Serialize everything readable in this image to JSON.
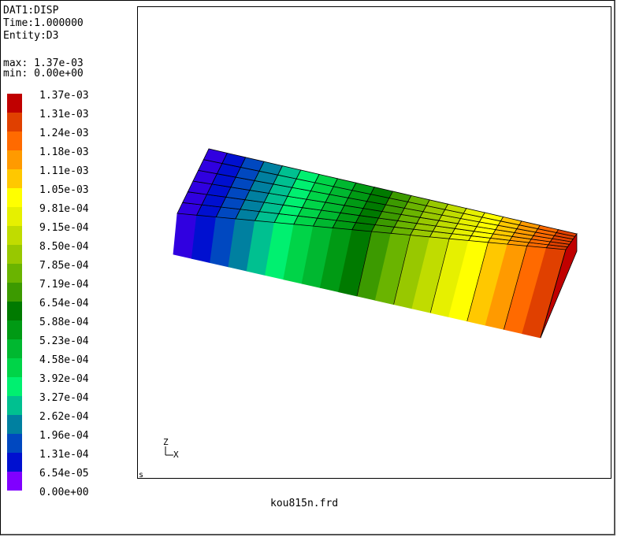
{
  "info": {
    "dataset": "DAT1:DISP",
    "time": "Time:1.000000",
    "entity": "Entity:D3"
  },
  "range": {
    "max": "max: 1.37e-03",
    "min": "min: 0.00e+00"
  },
  "legend": {
    "entries": [
      {
        "label": "1.37e-03",
        "color": "#c00000"
      },
      {
        "label": "1.31e-03",
        "color": "#e04000"
      },
      {
        "label": "1.24e-03",
        "color": "#ff6a00"
      },
      {
        "label": "1.18e-03",
        "color": "#ff9a00"
      },
      {
        "label": "1.11e-03",
        "color": "#ffc800"
      },
      {
        "label": "1.05e-03",
        "color": "#ffff00"
      },
      {
        "label": "9.81e-04",
        "color": "#e6f000"
      },
      {
        "label": "9.15e-04",
        "color": "#c0dc00"
      },
      {
        "label": "8.50e-04",
        "color": "#98c800"
      },
      {
        "label": "7.85e-04",
        "color": "#6ab400"
      },
      {
        "label": "7.19e-04",
        "color": "#3c9a00"
      },
      {
        "label": "6.54e-04",
        "color": "#007a00"
      },
      {
        "label": "5.88e-04",
        "color": "#009a14"
      },
      {
        "label": "5.23e-04",
        "color": "#00b830"
      },
      {
        "label": "4.58e-04",
        "color": "#00d448"
      },
      {
        "label": "3.92e-04",
        "color": "#00f070"
      },
      {
        "label": "3.27e-04",
        "color": "#00c090"
      },
      {
        "label": "2.62e-04",
        "color": "#0080a0"
      },
      {
        "label": "1.96e-04",
        "color": "#0048c0"
      },
      {
        "label": "1.31e-04",
        "color": "#0010d0"
      },
      {
        "label": "6.54e-05",
        "color": "#3000e0"
      },
      {
        "label": "0.00e+00",
        "color": "#8000ff"
      }
    ]
  },
  "axes": {
    "z": "Z",
    "x": "X"
  },
  "viewport_marker": "s",
  "filename": "kou815n.frd"
}
